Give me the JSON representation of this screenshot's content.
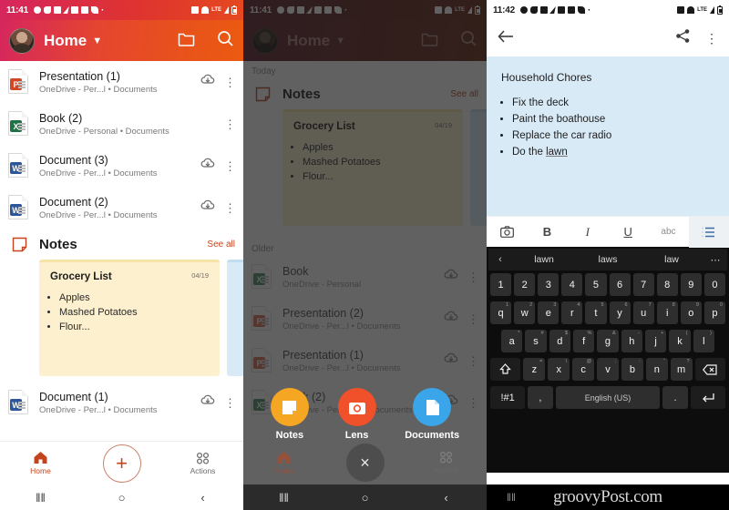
{
  "panel1": {
    "status": {
      "time": "11:41",
      "left_icons": [
        "account-icon",
        "cloud-icon",
        "image-icon",
        "flash-icon",
        "photos-icon",
        "book-icon",
        "twitter-icon",
        "dot-icon"
      ],
      "right_icons": [
        "alarm-icon",
        "hotspot-icon",
        "lte-icon",
        "signal-icon",
        "battery-icon"
      ]
    },
    "appbar": {
      "title": "Home",
      "chevron": "⌄",
      "folder_icon": "folder-icon",
      "search_icon": "search-icon"
    },
    "files": [
      {
        "name": "Presentation (1)",
        "sub": "OneDrive - Per...l • Documents",
        "type": "ppt",
        "badge": "P",
        "cloud": true
      },
      {
        "name": "Book (2)",
        "sub": "OneDrive - Personal • Documents",
        "type": "xls",
        "badge": "X",
        "cloud": false
      },
      {
        "name": "Document (3)",
        "sub": "OneDrive - Per...l • Documents",
        "type": "doc",
        "badge": "W",
        "cloud": true
      },
      {
        "name": "Document (2)",
        "sub": "OneDrive - Per...l • Documents",
        "type": "doc",
        "badge": "W",
        "cloud": true
      }
    ],
    "notes_section": {
      "title": "Notes",
      "see_all": "See all",
      "icon": "note-icon"
    },
    "note_card": {
      "title": "Grocery List",
      "date": "04/19",
      "items": [
        "Apples",
        "Mashed Potatoes",
        "Flour..."
      ]
    },
    "file_after_notes": {
      "name": "Document (1)",
      "sub": "OneDrive - Per...l • Documents",
      "type": "doc",
      "badge": "W",
      "cloud": true
    },
    "bottom_nav": {
      "home_label": "Home",
      "actions_label": "Actions",
      "fab_label": "+"
    },
    "sysnav": {
      "recents": "‖‖",
      "home": "○",
      "back": "‹"
    }
  },
  "panel2": {
    "status": {
      "time": "11:41"
    },
    "appbar": {
      "title": "Home"
    },
    "group_today": "Today",
    "group_older": "Older",
    "notes_section": {
      "title": "Notes",
      "see_all": "See all"
    },
    "note_card": {
      "title": "Grocery List",
      "date": "04/19",
      "items": [
        "Apples",
        "Mashed Potatoes",
        "Flour..."
      ]
    },
    "files": [
      {
        "name": "Book",
        "sub": "OneDrive - Personal",
        "type": "xls",
        "badge": "X"
      },
      {
        "name": "Presentation (2)",
        "sub": "OneDrive - Per...l • Documents",
        "type": "ppt",
        "badge": "P"
      },
      {
        "name": "Presentation (1)",
        "sub": "OneDrive - Per...l • Documents",
        "type": "ppt",
        "badge": "P"
      },
      {
        "name": "Book (2)",
        "sub": "OneDrive - Personal • Documents",
        "type": "xls",
        "badge": "X"
      }
    ],
    "fab_menu": [
      {
        "label": "Notes",
        "icon": "sticky-note-icon",
        "color": "#f5a623"
      },
      {
        "label": "Lens",
        "icon": "camera-icon",
        "color": "#f0502a"
      },
      {
        "label": "Documents",
        "icon": "document-icon",
        "color": "#3aa5e8"
      }
    ],
    "bottom_nav": {
      "home_label": "Home",
      "actions_label": "Actions",
      "fab_label": "×"
    }
  },
  "panel3": {
    "status": {
      "time": "11:42"
    },
    "toolbar": {
      "back_icon": "back-arrow-icon",
      "share_icon": "share-icon",
      "more_icon": "more-vertical-icon"
    },
    "note": {
      "title": "Household Chores",
      "items": [
        "Fix the deck",
        "Paint the boathouse",
        "Replace the car radio",
        "Do the lawn"
      ],
      "underlined_word": "lawn",
      "background": "#d9eaf7"
    },
    "format_bar": [
      {
        "label": "📷",
        "name": "camera-icon",
        "selected": false
      },
      {
        "label": "B",
        "name": "bold-button",
        "selected": false
      },
      {
        "label": "I",
        "name": "italic-button",
        "selected": false
      },
      {
        "label": "U",
        "name": "underline-button",
        "selected": false
      },
      {
        "label": "abc",
        "name": "strikethrough-button",
        "selected": false
      },
      {
        "label": "≡",
        "name": "list-button",
        "selected": true
      }
    ],
    "keyboard": {
      "suggestions": [
        "lawn",
        "laws",
        "law"
      ],
      "left_icon": "chevron-left-icon",
      "right_icon": "more-horizontal-icon",
      "row_numbers": [
        "1",
        "2",
        "3",
        "4",
        "5",
        "6",
        "7",
        "8",
        "9",
        "0"
      ],
      "row1": [
        {
          "k": "q",
          "s": "1"
        },
        {
          "k": "w",
          "s": "2"
        },
        {
          "k": "e",
          "s": "3"
        },
        {
          "k": "r",
          "s": "4"
        },
        {
          "k": "t",
          "s": "5"
        },
        {
          "k": "y",
          "s": "6"
        },
        {
          "k": "u",
          "s": "7"
        },
        {
          "k": "i",
          "s": "8"
        },
        {
          "k": "o",
          "s": "9"
        },
        {
          "k": "p",
          "s": "0"
        }
      ],
      "row2": [
        {
          "k": "a",
          "s": "*"
        },
        {
          "k": "s",
          "s": "#"
        },
        {
          "k": "d",
          "s": "$"
        },
        {
          "k": "f",
          "s": "%"
        },
        {
          "k": "g",
          "s": "&"
        },
        {
          "k": "h",
          "s": "-"
        },
        {
          "k": "j",
          "s": "+"
        },
        {
          "k": "k",
          "s": "("
        },
        {
          "k": "l",
          "s": ")"
        }
      ],
      "row3": [
        {
          "k": "z",
          "s": "="
        },
        {
          "k": "x",
          "s": "\\"
        },
        {
          "k": "c",
          "s": "@"
        },
        {
          "k": "v",
          "s": ";"
        },
        {
          "k": "b",
          "s": ":"
        },
        {
          "k": "n",
          "s": "“"
        },
        {
          "k": "m",
          "s": "?"
        }
      ],
      "shift_icon": "shift-icon",
      "backspace_icon": "backspace-icon",
      "symbols_key": "!#1",
      "comma_key": ",",
      "space_key": "English (US)",
      "period_key": ".",
      "enter_icon": "enter-icon"
    },
    "watermark": {
      "text": "groovyPost.com",
      "menu_icon": "recents-icon"
    }
  }
}
